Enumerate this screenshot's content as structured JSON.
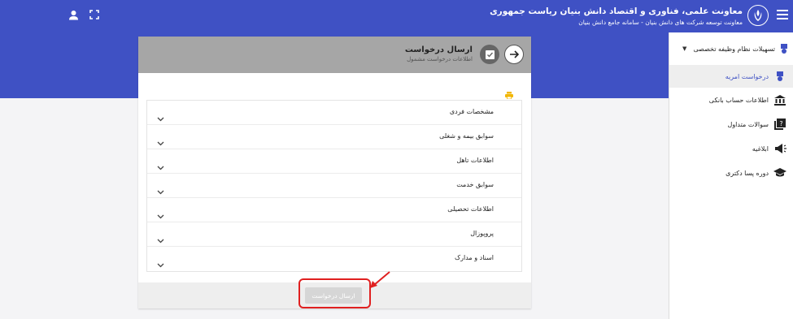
{
  "header": {
    "title": "معاونت علمی، فناوری و اقتصاد دانش بنیان ریاست جمهوری",
    "subtitle": "معاونت توسعه شرکت های دانش بنیان - سامانه جامع دانش بنیان",
    "accent_color": "#3f51c4",
    "icons": [
      "menu-icon",
      "emblem-icon",
      "fullscreen-icon",
      "user-icon"
    ]
  },
  "sidebar": {
    "group_label": "تسهیلات نظام وظیفه تخصصی",
    "items": [
      {
        "label": "درخواست امریه",
        "icon": "award-icon",
        "active": true
      },
      {
        "label": "اطلاعات حساب بانکی",
        "icon": "bank-icon",
        "active": false
      },
      {
        "label": "سوالات متداول",
        "icon": "question-book-icon",
        "active": false
      },
      {
        "label": "ابلاغیه",
        "icon": "megaphone-icon",
        "active": false
      },
      {
        "label": "دوره پسا دکتری",
        "icon": "graduation-cap-icon",
        "active": false
      }
    ]
  },
  "card": {
    "title": "ارسال درخواست",
    "subtitle": "اطلاعات درخواست مشمول",
    "sections": [
      {
        "label": "مشخصات فردی"
      },
      {
        "label": "سوابق بیمه و شغلی"
      },
      {
        "label": "اطلاعات تاهل"
      },
      {
        "label": "سوابق خدمت"
      },
      {
        "label": "اطلاعات تحصیلی"
      },
      {
        "label": "پروپوزال"
      },
      {
        "label": "اسناد و مدارک"
      }
    ],
    "submit_label": "ارسال درخواست"
  }
}
